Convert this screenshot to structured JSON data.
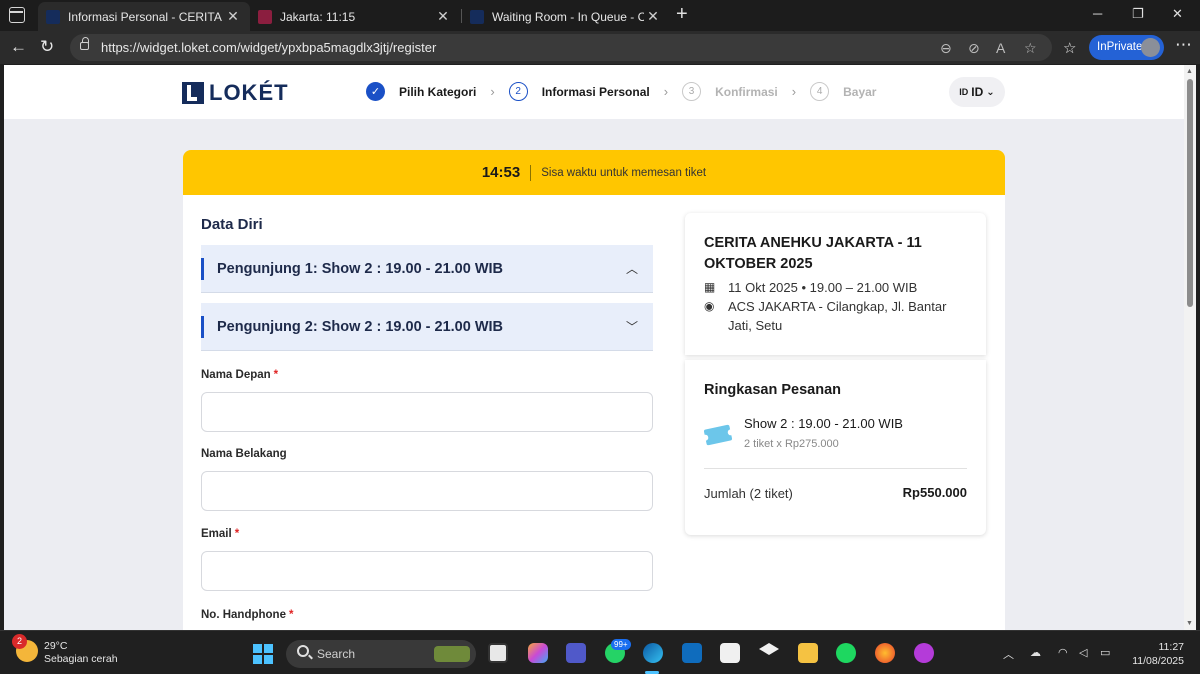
{
  "browser": {
    "tabs": [
      {
        "title": "Informasi Personal - CERITA ANEHKU JAKARTA",
        "favicon_color": "#152c5b",
        "active": true
      },
      {
        "title": "Jakarta: 11:15",
        "favicon_color": "#8b1e3f",
        "active": false
      },
      {
        "title": "Waiting Room - In Queue - CERITA ANEHKU",
        "favicon_color": "#152c5b",
        "active": false
      }
    ],
    "url": "https://widget.loket.com/widget/ypxbpa5magdlx3jtj/register",
    "inprivate_label": "InPrivate"
  },
  "header": {
    "logo_text": "LOKÉT",
    "steps": [
      {
        "number": "✓",
        "label": "Pilih Kategori",
        "state": "done"
      },
      {
        "number": "2",
        "label": "Informasi Personal",
        "state": "current"
      },
      {
        "number": "3",
        "label": "Konfirmasi",
        "state": "todo"
      },
      {
        "number": "4",
        "label": "Bayar",
        "state": "todo"
      }
    ],
    "language": {
      "flag": "ID",
      "code": "ID"
    }
  },
  "timer": {
    "time": "14:53",
    "text": "Sisa waktu untuk memesan tiket"
  },
  "form": {
    "section_title": "Data Diri",
    "accordions": [
      {
        "label": "Pengunjung 1: Show 2 : 19.00 - 21.00 WIB",
        "icon": "chevron-up-icon"
      },
      {
        "label": "Pengunjung 2: Show 2 : 19.00 - 21.00 WIB",
        "icon": "chevron-down-icon"
      }
    ],
    "fields": [
      {
        "label": "Nama Depan",
        "required": "*",
        "value": ""
      },
      {
        "label": "Nama Belakang",
        "required": "",
        "value": ""
      },
      {
        "label": "Email",
        "required": "*",
        "value": ""
      },
      {
        "label": "No. Handphone",
        "required": "*",
        "value": ""
      }
    ]
  },
  "event": {
    "title": "CERITA ANEHKU JAKARTA - 11 OKTOBER 2025",
    "datetime": "11 Okt 2025 • 19.00 – 21.00 WIB",
    "location": "ACS JAKARTA - Cilangkap, Jl. Bantar Jati, Setu"
  },
  "order": {
    "title": "Ringkasan Pesanan",
    "show": "Show 2 : 19.00 - 21.00 WIB",
    "quantity": "2 tiket x Rp275.000",
    "sum_label": "Jumlah (2 tiket)",
    "total": "Rp550.000"
  },
  "taskbar": {
    "weather_badge": "2",
    "temperature": "29°C",
    "condition": "Sebagian cerah",
    "search_placeholder": "Search",
    "whatsapp_badge": "99+",
    "time": "11:27",
    "date": "11/08/2025"
  },
  "colors": {
    "accent": "#1a50c6",
    "brand": "#152c5b",
    "timer_bg": "#ffc600",
    "required": "#e02424"
  }
}
